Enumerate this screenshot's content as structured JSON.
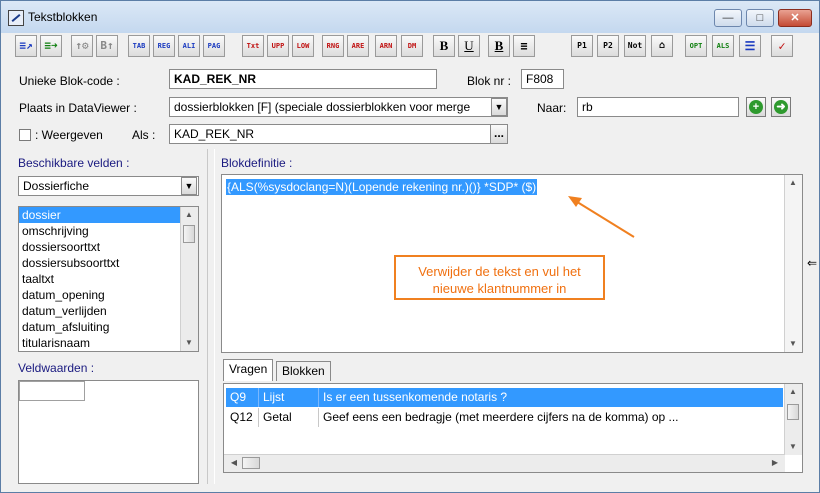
{
  "window": {
    "title": "Tekstblokken"
  },
  "toolbar": {
    "buttons": [
      "TAB",
      "REG",
      "ALI",
      "PAG",
      "Txt",
      "UPP",
      "LOW",
      "RNG",
      "ARE",
      "ARN",
      "DM",
      "B",
      "U",
      "B",
      "P1",
      "P2",
      "Not",
      "OPT",
      "ALS"
    ]
  },
  "form": {
    "blok_code_label": "Unieke Blok-code :",
    "blok_code_value": "KAD_REK_NR",
    "blok_nr_label": "Blok nr :",
    "blok_nr_value": "F808",
    "plaats_label": "Plaats in DataViewer :",
    "plaats_value": "dossierblokken [F] (speciale dossierblokken voor merge",
    "naar_label": "Naar:",
    "naar_value": "rb",
    "weergeven_label": ": Weergeven",
    "als_label": "Als :",
    "als_value": "KAD_REK_NR",
    "dots": "..."
  },
  "left_panel": {
    "velden_label": "Beschikbare velden :",
    "velden_combo_value": "Dossierfiche",
    "fields": [
      "dossier",
      "omschrijving",
      "dossiersoorttxt",
      "dossiersubsoorttxt",
      "taaltxt",
      "datum_opening",
      "datum_verlijden",
      "datum_afsluiting",
      "titularisnaam"
    ],
    "veldwaarden_label": "Veldwaarden :"
  },
  "definition": {
    "label": "Blokdefinitie :",
    "text": "{ALS(%sysdoclang=N)(Lopende rekening nr.)()} *SDP* ($)",
    "callout_line1": "Verwijder de tekst en vul het",
    "callout_line2": "nieuwe klantnummer in",
    "callout_color": "#f08020"
  },
  "tabs": [
    {
      "label": "Vragen"
    },
    {
      "label": "Blokken"
    }
  ],
  "questions": [
    {
      "id": "Q9",
      "type": "Lijst",
      "text": "Is er een tussenkomende notaris ?"
    },
    {
      "id": "Q12",
      "type": "Getal",
      "text": "Geef eens een bedragje (met meerdere cijfers na de komma) op ..."
    }
  ]
}
